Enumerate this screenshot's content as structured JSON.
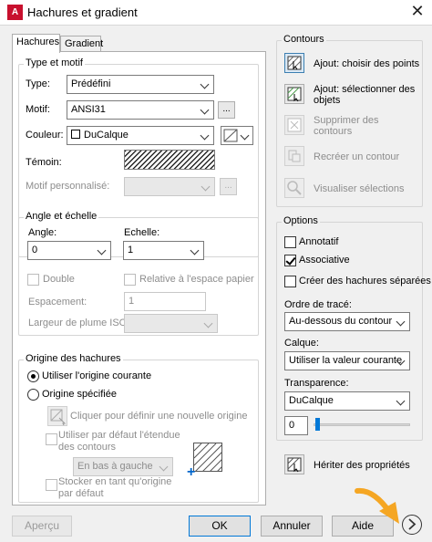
{
  "window": {
    "title": "Hachures et gradient",
    "app_icon": "A"
  },
  "tabs": [
    {
      "label": "Hachures"
    },
    {
      "label": "Gradient"
    }
  ],
  "type_motif": {
    "legend": "Type et motif",
    "type_label": "Type:",
    "type_value": "Prédéfini",
    "motif_label": "Motif:",
    "motif_value": "ANSI31",
    "motif_browse": "...",
    "couleur_label": "Couleur:",
    "couleur_value": "DuCalque",
    "temoin_label": "Témoin:",
    "motif_perso_label": "Motif personnalisé:",
    "motif_perso_browse": "..."
  },
  "angle_echelle": {
    "legend": "Angle et échelle",
    "angle_label": "Angle:",
    "angle_value": "0",
    "echelle_label": "Echelle:",
    "echelle_value": "1",
    "double_label": "Double",
    "relative_label": "Relative à l'espace papier",
    "espacement_label": "Espacement:",
    "espacement_value": "1",
    "largeur_label": "Largeur de plume ISO:"
  },
  "origine": {
    "legend": "Origine des hachures",
    "courante_label": "Utiliser l'origine courante",
    "specifiee_label": "Origine spécifiée",
    "cliquer_label": "Cliquer pour définir une nouvelle origine",
    "defaut_line1": "Utiliser par défaut l'étendue",
    "defaut_line2": "des contours",
    "position_value": "En bas à gauche",
    "stocker_line1": "Stocker en tant qu'origine",
    "stocker_line2": "par défaut"
  },
  "contours": {
    "legend": "Contours",
    "ajout_points": "Ajout: choisir des points",
    "ajout_objets_line1": "Ajout: sélectionner des",
    "ajout_objets_line2": "objets",
    "supprimer_line1": "Supprimer des",
    "supprimer_line2": "contours",
    "recreer": "Recréer un contour",
    "visualiser": "Visualiser sélections"
  },
  "options": {
    "legend": "Options",
    "annotatif": "Annotatif",
    "associative": "Associative",
    "separees": "Créer des hachures séparées",
    "ordre_label": "Ordre de tracé:",
    "ordre_value": "Au-dessous du contour",
    "calque_label": "Calque:",
    "calque_value": "Utiliser la valeur courante",
    "transparence_label": "Transparence:",
    "transparence_value": "DuCalque",
    "transparence_number": "0",
    "transparence_slider_level": 0
  },
  "heriter": "Hériter des propriétés",
  "buttons": {
    "apercu": "Aperçu",
    "ok": "OK",
    "annuler": "Annuler",
    "aide": "Aide"
  },
  "colors": {
    "arrow": "#f5a623",
    "title_icon": "#c8102e",
    "origin_marker": "#0066cc"
  }
}
